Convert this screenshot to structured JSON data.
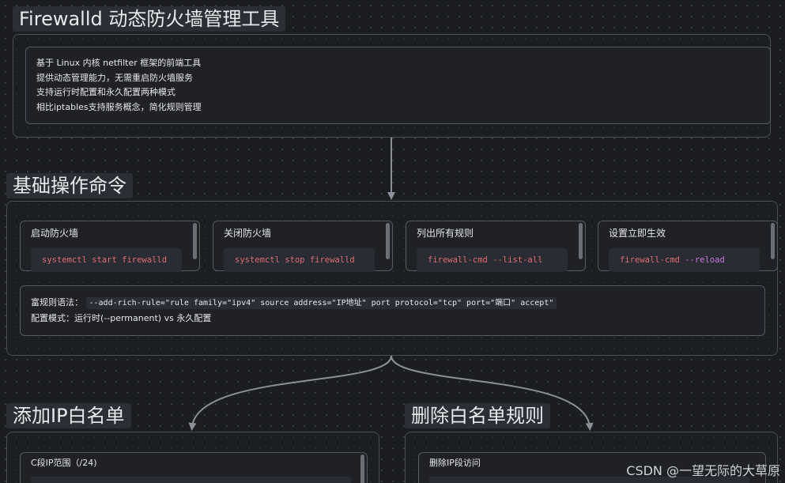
{
  "nodes": {
    "firewalld": {
      "title": "Firewalld 动态防火墙管理工具",
      "lines": [
        "基于 Linux 内核 netfilter 框架的前端工具",
        "提供动态管理能力，无需重启防火墙服务",
        "支持运行时配置和永久配置两种模式",
        "相比iptables支持服务概念，简化规则管理"
      ]
    },
    "basic_ops": {
      "title": "基础操作命令",
      "commands": [
        {
          "title": "启动防火墙",
          "code": "systemctl start firewalld"
        },
        {
          "title": "关闭防火墙",
          "code": "systemctl stop firewalld"
        },
        {
          "title": "列出所有规则",
          "code": "firewall-cmd --list-all"
        },
        {
          "title": "设置立即生效",
          "code_main": "firewall-cmd ",
          "code_flag": "--reload"
        }
      ],
      "rich_rule_label": "富规则语法：",
      "rich_rule_code": "--add-rich-rule=\"rule family=\"ipv4\" source address=\"IP地址\" port protocol=\"tcp\" port=\"端口\" accept\"",
      "config_mode": "配置模式：运行时(--permanent) vs 永久配置"
    },
    "whitelist_add": {
      "title": "添加IP白名单",
      "sub_title": "C段IP范围（/24)"
    },
    "whitelist_remove": {
      "title": "删除白名单规则",
      "sub_title": "删除IP段访问"
    }
  },
  "edges": [
    {
      "from": "firewalld",
      "to": "basic_ops"
    },
    {
      "from": "basic_ops",
      "to": "whitelist_add"
    },
    {
      "from": "basic_ops",
      "to": "whitelist_remove"
    }
  ],
  "watermark": "CSDN @一望无际的大草原",
  "colors": {
    "background": "#1b1d21",
    "command_code": "#e06c75",
    "flag_code": "#c678dd",
    "connector": "#8c9098"
  }
}
